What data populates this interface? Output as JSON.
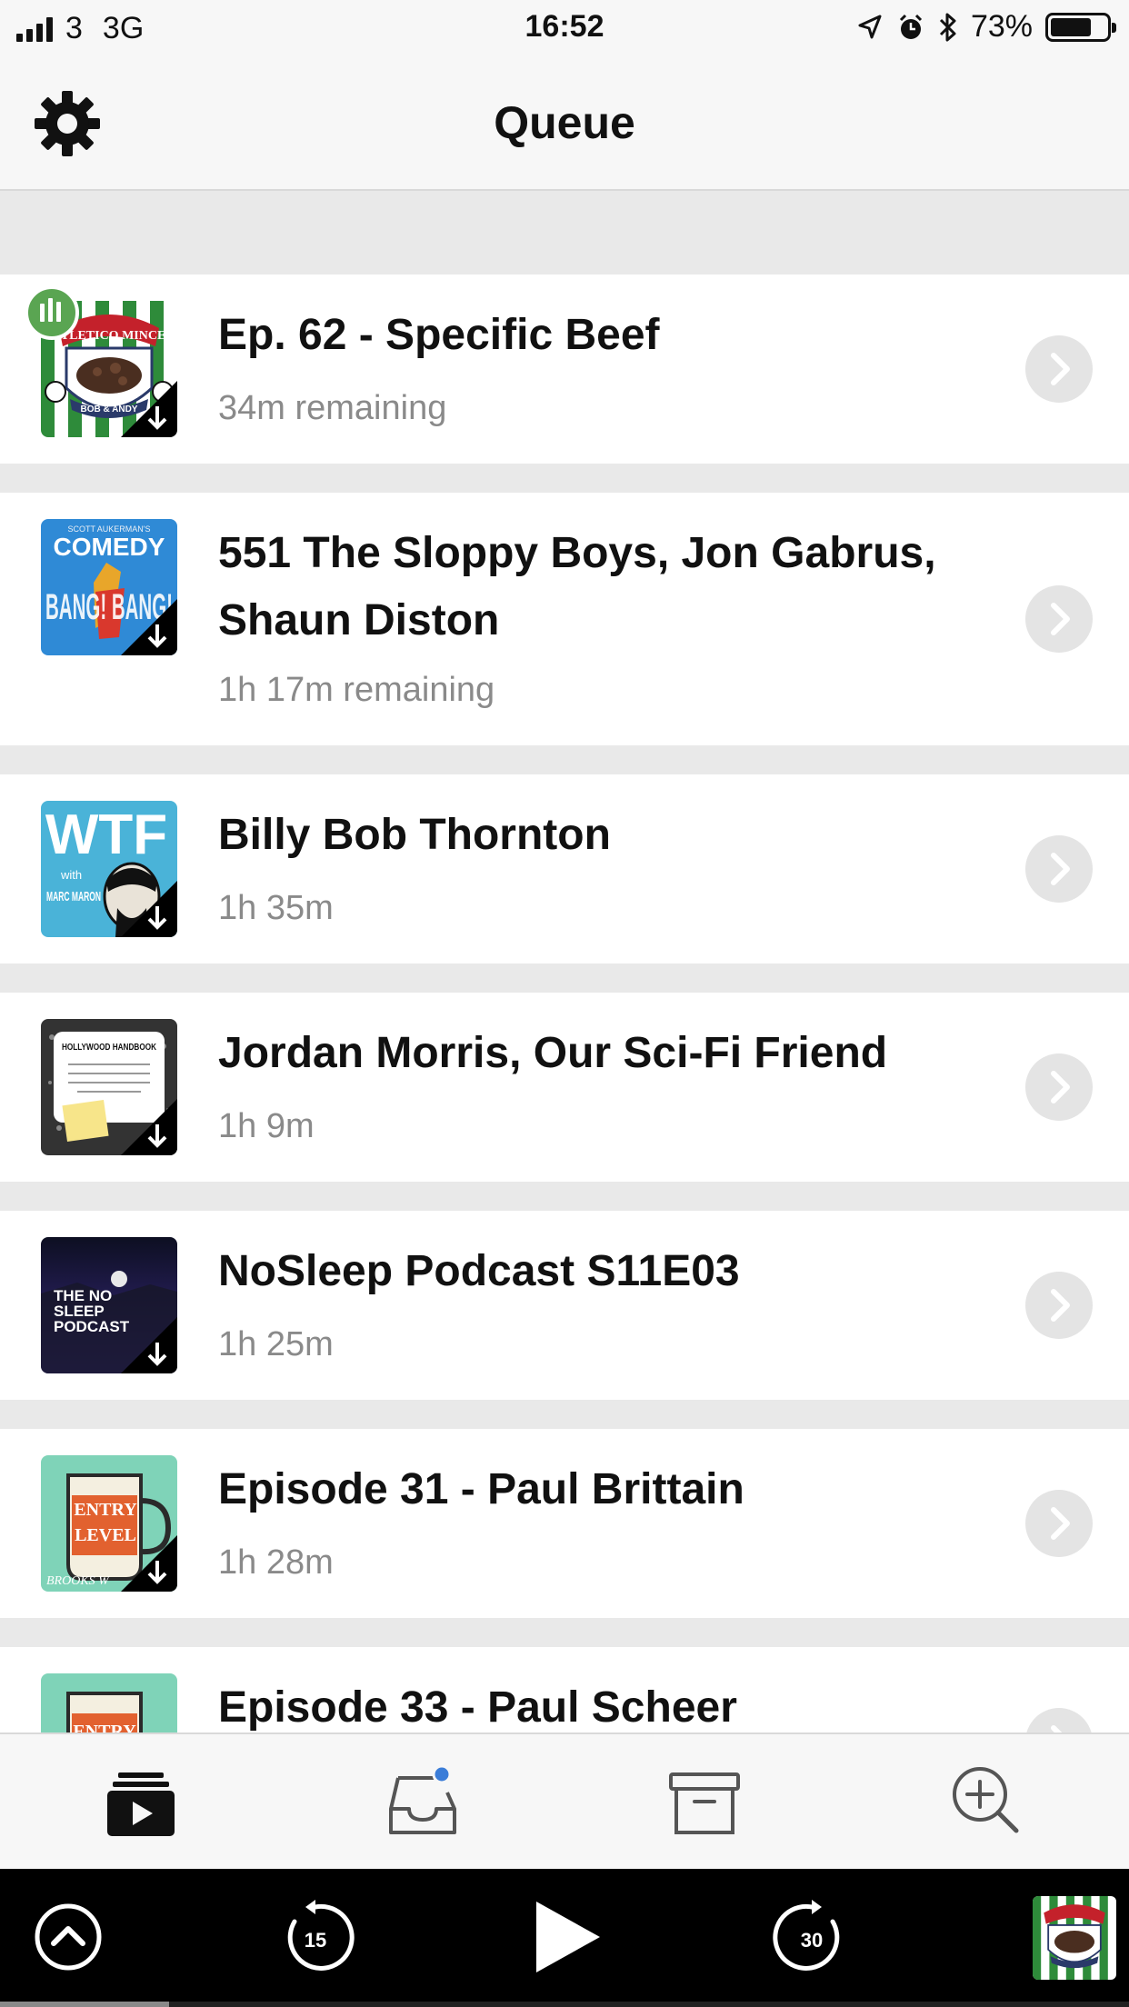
{
  "status_bar": {
    "carrier": "3",
    "network": "3G",
    "time": "16:52",
    "battery_text": "73%",
    "battery_level": 0.73
  },
  "header": {
    "title": "Queue"
  },
  "episodes": [
    {
      "title": "Ep. 62 - Specific Beef",
      "subtitle": "34m remaining",
      "art_name": "atletico-mince-artwork",
      "art_text": "ATLETICO MINCE",
      "art_text_2": "BOB & ANDY",
      "downloaded": true,
      "now_playing": true
    },
    {
      "title": "551 The Sloppy Boys, Jon Gabrus, Shaun Diston",
      "subtitle": "1h 17m remaining",
      "art_name": "comedy-bang-bang-artwork",
      "art_text": "COMEDY",
      "art_text_2": "BANG! BANG!",
      "art_text_3": "SCOTT AUKERMAN'S",
      "downloaded": true
    },
    {
      "title": "Billy Bob Thornton",
      "subtitle": "1h 35m",
      "art_name": "wtf-marc-maron-artwork",
      "art_text": "WTF",
      "art_text_2": "with",
      "art_text_3": "MARC MARON",
      "downloaded": true
    },
    {
      "title": "Jordan Morris, Our Sci-Fi Friend",
      "subtitle": "1h 9m",
      "art_name": "hollywood-handbook-artwork",
      "art_text": "HOLLYWOOD HANDBOOK",
      "downloaded": true
    },
    {
      "title": "NoSleep Podcast S11E03",
      "subtitle": "1h 25m",
      "art_name": "nosleep-podcast-artwork",
      "art_text": "THE NO SLEEP PODCAST",
      "downloaded": true
    },
    {
      "title": "Episode 31 - Paul Brittain",
      "subtitle": "1h 28m",
      "art_name": "entry-level-artwork",
      "art_text": "ENTRY LEVEL",
      "art_text_2": "BROOKS W",
      "downloaded": true
    },
    {
      "title": "Episode 33 - Paul Scheer",
      "subtitle": "",
      "art_name": "entry-level-artwork",
      "art_text": "ENTRY",
      "downloaded": true
    }
  ],
  "tabbar": {
    "tabs": [
      {
        "name": "queue",
        "icon": "queue-icon",
        "active": true
      },
      {
        "name": "inbox",
        "icon": "inbox-icon",
        "badge": true
      },
      {
        "name": "archive",
        "icon": "archive-icon"
      },
      {
        "name": "add-podcast",
        "icon": "search-plus-icon"
      }
    ]
  },
  "player": {
    "skip_back_seconds": "15",
    "skip_forward_seconds": "30",
    "progress": 0.15
  },
  "colors": {
    "accent_green": "#5aa552",
    "badge_blue": "#3b7dd8",
    "subtitle_gray": "#8a8a8a",
    "separator_gray": "#e9e9e9"
  }
}
